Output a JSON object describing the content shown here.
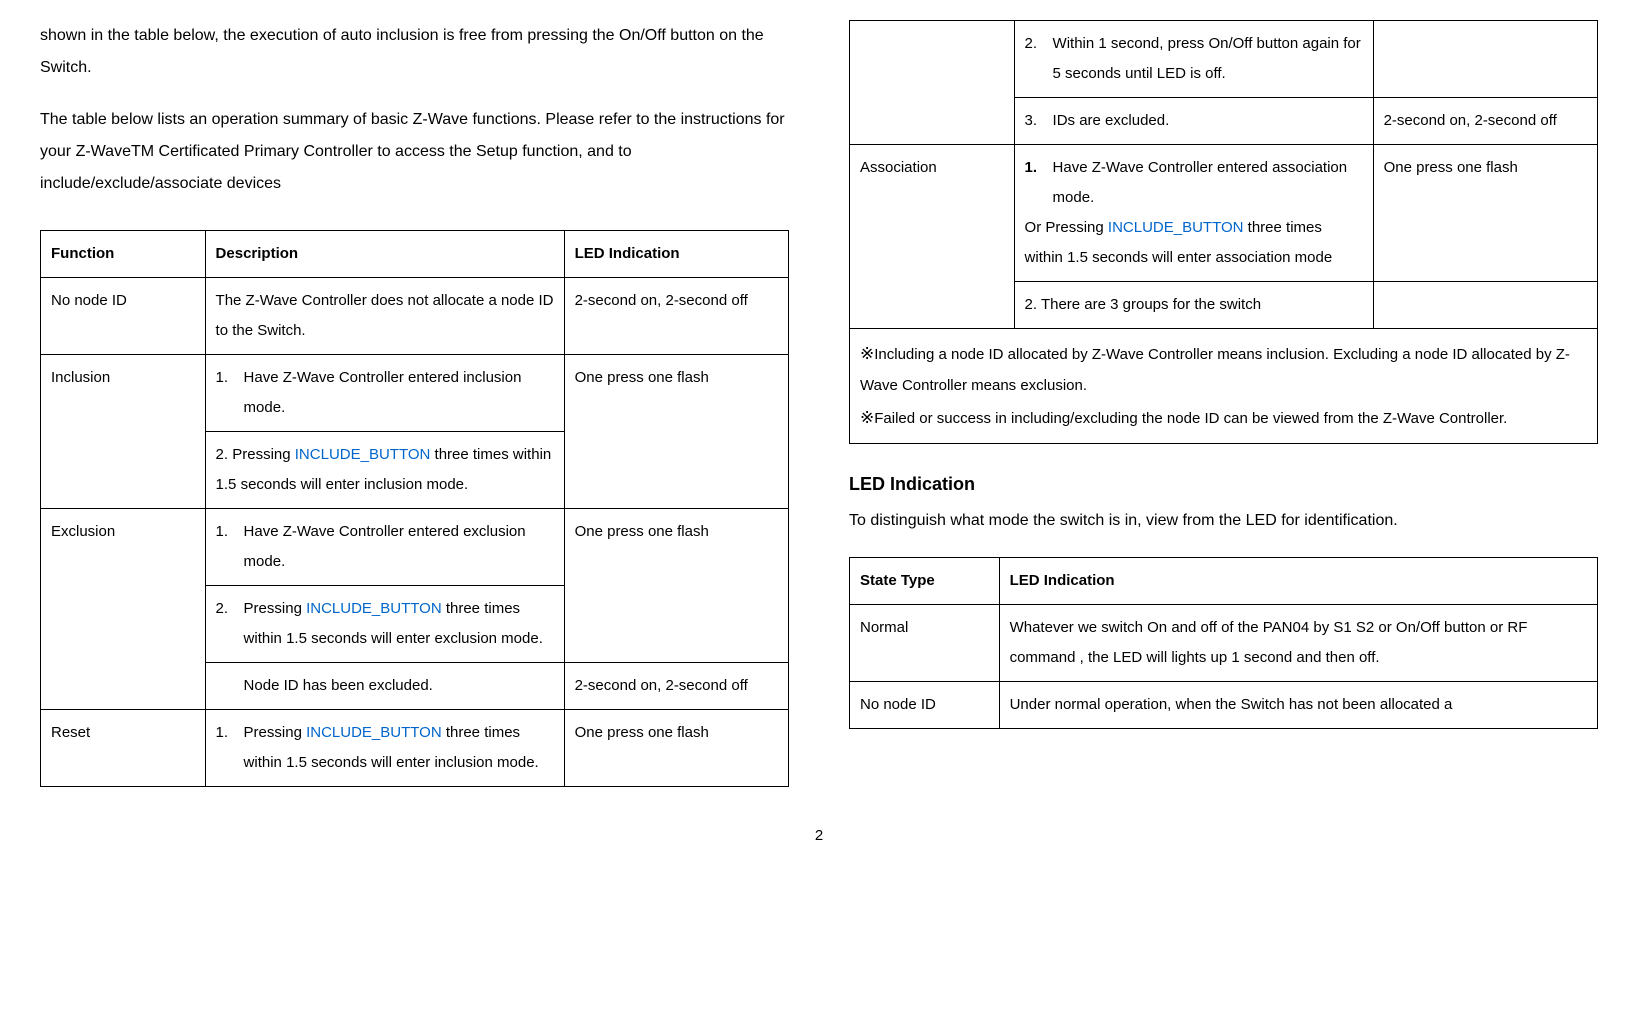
{
  "left": {
    "para1": "shown in the table below, the execution of auto inclusion is free from pressing the On/Off button on the Switch.",
    "para2": "The table below lists an operation summary of basic Z-Wave functions. Please refer to the instructions for your Z-WaveTM Certificated Primary Controller to access the Setup function, and to include/exclude/associate devices",
    "table1": {
      "headers": {
        "h1": "Function",
        "h2": "Description",
        "h3": "LED Indication"
      },
      "row_no_node": {
        "func": "No node ID",
        "desc": "The Z-Wave Controller does not allocate a node ID to the Switch.",
        "led": "2-second on, 2-second off"
      },
      "row_inclusion": {
        "func": "Inclusion",
        "d1_num": "1.",
        "d1_txt": "Have Z-Wave Controller entered inclusion mode.",
        "d2_num": "2.",
        "d2_pre": "Pressing ",
        "d2_link": "INCLUDE_BUTTON",
        "d2_post": " three times within 1.5 seconds will enter inclusion mode.",
        "led": "One press one flash"
      },
      "row_exclusion": {
        "func": "Exclusion",
        "d1_num": "1.",
        "d1_txt": "Have Z-Wave Controller entered exclusion mode.",
        "d2_num": "2.",
        "d2_pre": "Pressing ",
        "d2_link": "INCLUDE_BUTTON",
        "d2_post": " three times within 1.5 seconds will enter exclusion mode.",
        "led": "One press one flash",
        "d3_txt": "Node ID has been excluded.",
        "led3": "2-second on, 2-second off"
      },
      "row_reset": {
        "func": "Reset",
        "d1_num": "1.",
        "d1_pre": "Pressing ",
        "d1_link": "INCLUDE_BUTTON",
        "d1_post": " three times within 1.5 seconds will enter inclusion mode.",
        "led": "One press one flash"
      }
    }
  },
  "right": {
    "table_cont": {
      "reset2": {
        "num": "2.",
        "txt": "Within 1 second, press On/Off button again for 5 seconds until LED is off."
      },
      "reset3": {
        "num": "3.",
        "txt": "IDs are excluded.",
        "led": "2-second on, 2-second off"
      },
      "assoc": {
        "func": "Association",
        "d1_num": "1.",
        "d1_txt": "Have Z-Wave Controller entered association mode.",
        "or_pre": "Or  Pressing ",
        "or_link": "INCLUDE_BUTTON",
        "or_post": " three times within 1.5 seconds will enter association mode",
        "led": "One press one flash",
        "d2_txt": "2.  There are 3 groups for the switch"
      },
      "note1_sym": "※",
      "note1": "Including a node ID allocated by Z-Wave Controller means inclusion.  Excluding a node ID allocated by Z-Wave Controller means exclusion.",
      "note2_sym": "※",
      "note2": "Failed or success in including/excluding the node ID can be viewed from the Z-Wave Controller."
    },
    "led_heading": "LED Indication",
    "led_intro": "To distinguish what mode the switch is in, view from the LED for identification.",
    "table2": {
      "headers": {
        "h1": "State Type",
        "h2": "LED Indication"
      },
      "row_normal": {
        "state": "Normal",
        "led": "Whatever we switch On and off of the PAN04 by S1 S2 or On/Off button or RF command , the LED will lights up 1 second and then off."
      },
      "row_no_node": {
        "state": "No node ID",
        "led": "Under normal operation, when the Switch has not been allocated a"
      }
    }
  },
  "page_number": "2"
}
